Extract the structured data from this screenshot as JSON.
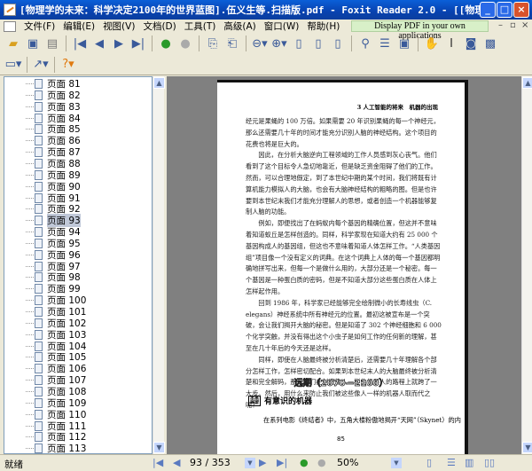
{
  "window": {
    "title": "[物理学的未来：科学决定2100年的世界蓝图].伍义生等.扫描版.pdf - Foxit Reader 2.0 - [[物理学的未来..."
  },
  "menu": [
    "文件(F)",
    "编辑(E)",
    "视图(V)",
    "文档(D)",
    "工具(T)",
    "高级(A)",
    "窗口(W)",
    "帮助(H)"
  ],
  "ad_label": "Display PDF in your own applications",
  "sidebar": {
    "pages": [
      "页面 81",
      "页面 82",
      "页面 83",
      "页面 84",
      "页面 85",
      "页面 86",
      "页面 87",
      "页面 88",
      "页面 89",
      "页面 90",
      "页面 91",
      "页面 92",
      "页面 93",
      "页面 94",
      "页面 95",
      "页面 96",
      "页面 97",
      "页面 98",
      "页面 99",
      "页面 100",
      "页面 101",
      "页面 102",
      "页面 103",
      "页面 104",
      "页面 105",
      "页面 106",
      "页面 107",
      "页面 108",
      "页面 109",
      "页面 110",
      "页面 111",
      "页面 112",
      "页面 113"
    ],
    "selected": "页面 93"
  },
  "document": {
    "header": "3 人工智能的将来　机器的出现",
    "paragraphs": [
      {
        "indent": false,
        "text": "经元是果蝇的 100 万倍。如果需要 20 年识别果蝇的每一个神经元，那么还需要几十年的时间才能充分识别人脑的神经结构。这个项目的花费也将是巨大的。"
      },
      {
        "indent": true,
        "text": "因此，在分析大脑逆向工程领域的工作人员感到灰心丧气。他们看到了这个目标令人急切地靠近，但是缺乏资金阻碍了他们的工作。然而，可以合理地假定，到了本世纪中期的某个时间，我们将既有计算机能力模拟人的大脑，也会有大脑神经结构的粗略的图。但是也许要到本世纪末我们才能充分理解人的思想，或者创造一个机器能够复制人脑的功能。"
      },
      {
        "indent": true,
        "text": "例如，即便找出了在蚂蚁内每个基因的精确位置，但这并不意味着知道蚁丘是怎样创造的。同样，科学家现在知道大约有 25 000 个基因构成人的基因组，但这也不意味着知道人体怎样工作。“人类基因组”项目像一个没有定义的词典。在这个词典上人体的每一个基因都明确地拼写出来，但每一个是做什么用的，大部分还是一个秘密。每一个基因是一种蛋白质的密码，但是不知道大部分这些蛋白质在人体上怎样起作用。"
      },
      {
        "indent": true,
        "text": "回到 1986 年，科学家已经能够完全绘制微小的长寿线虫（C. elegans）神经系统中所有神经元的位置。最初这被宣布是一个突破，会让我们揭开大脑的秘密。但是知道了 302 个神经细胞和 6 000 个化学突触，并没有得出这个小虫子是如何工作的任何新的理解，甚至在几十年后的今天还是这样。"
      },
      {
        "indent": true,
        "text": "同样，即使在人脑最终被分析清楚后，还需要几十年理解各个部分怎样工作，怎样密切配合。如果到本世纪末人的大脑最终被分析清楚和完全解码，那么我们在创造像人一样的机器人的路程上就跨了一大步。然后，用什么来防止我们被这些像人一样的机器人取而代之呢？"
      }
    ],
    "section_title": "远期（2070—2100）",
    "subsection_badge": "未来 展望",
    "subsection_title": "有意识的机器",
    "last_line": "在系列电影《终结者》中，五角大楼粉傲地揭开“天网”（Skynet）的内",
    "page_number": "85"
  },
  "status": {
    "text": "就绪",
    "page_field": "93 / 353",
    "current_page": 93,
    "total_pages": 353,
    "zoom": "50%"
  }
}
